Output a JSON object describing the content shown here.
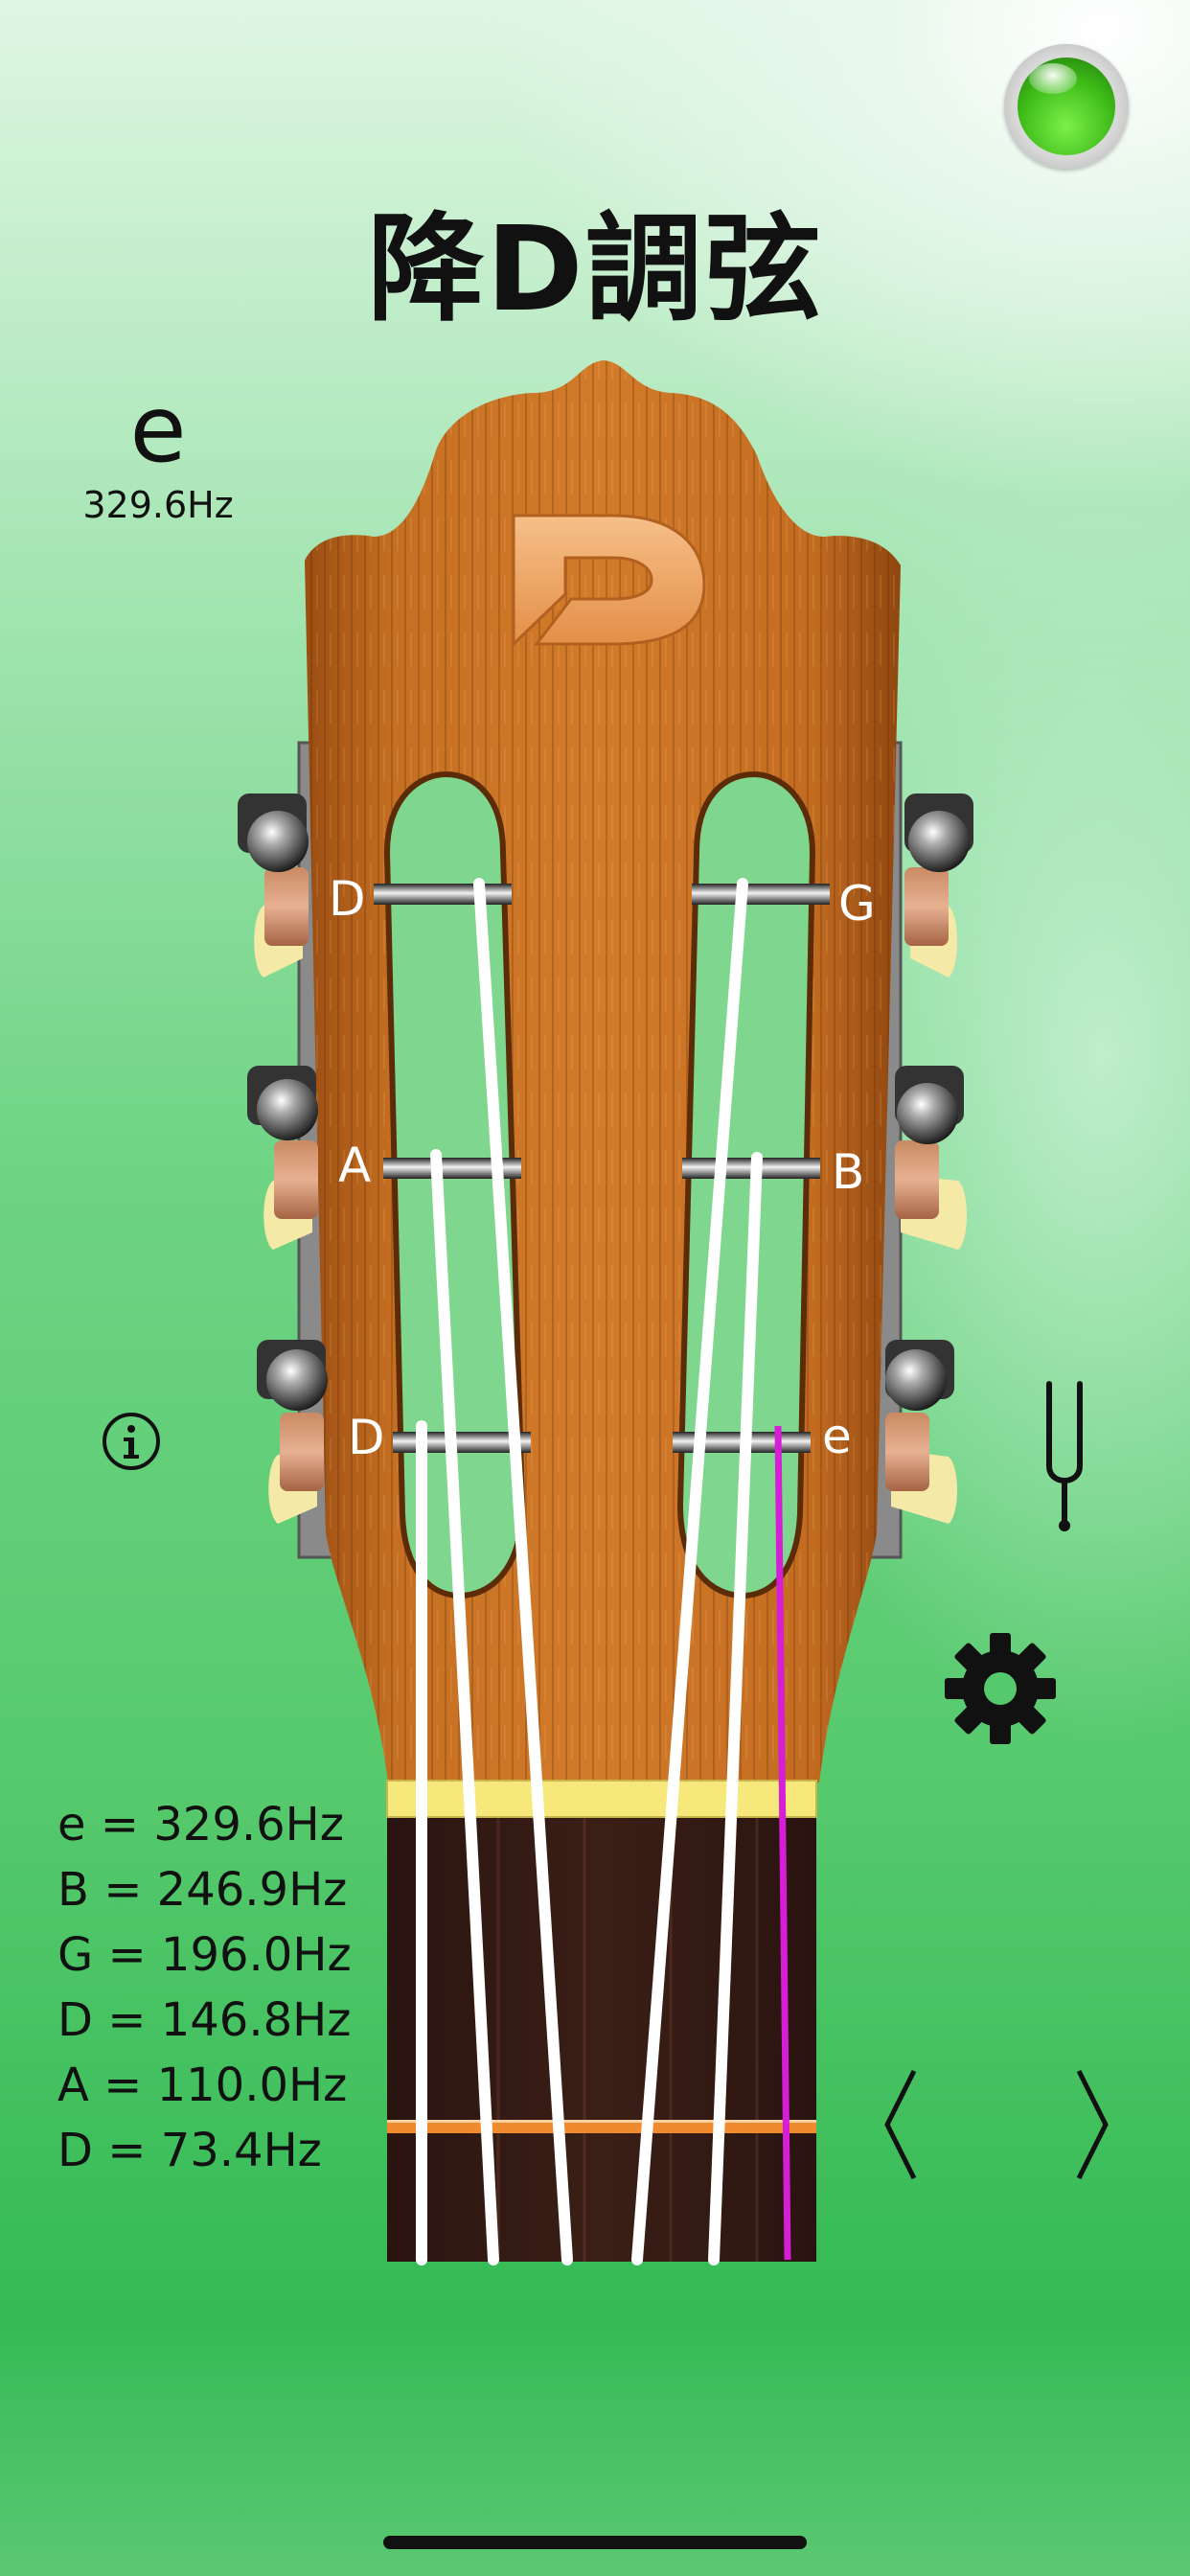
{
  "title": "降D調弦",
  "current_note": {
    "name": "e",
    "frequency": "329.6Hz"
  },
  "headstock": {
    "logo": "D",
    "left_labels": [
      "D",
      "A",
      "D"
    ],
    "right_labels": [
      "G",
      "B",
      "e"
    ]
  },
  "frequencies": [
    "e = 329.6Hz",
    "B = 246.9Hz",
    "G = 196.0Hz",
    "D = 146.8Hz",
    "A = 110.0Hz",
    "D = 73.4Hz"
  ],
  "icons": {
    "status": "status-led-icon",
    "info": "info-icon",
    "tuning_fork": "tuning-fork-icon",
    "settings": "gear-icon",
    "previous": "chevron-left-icon",
    "next": "chevron-right-icon"
  },
  "colors": {
    "led_active": "#3ebb18",
    "selected_string": "#d71ed7",
    "fret_marker": "#f08a2e",
    "nut": "#f6e87a"
  },
  "selected_string": "e"
}
